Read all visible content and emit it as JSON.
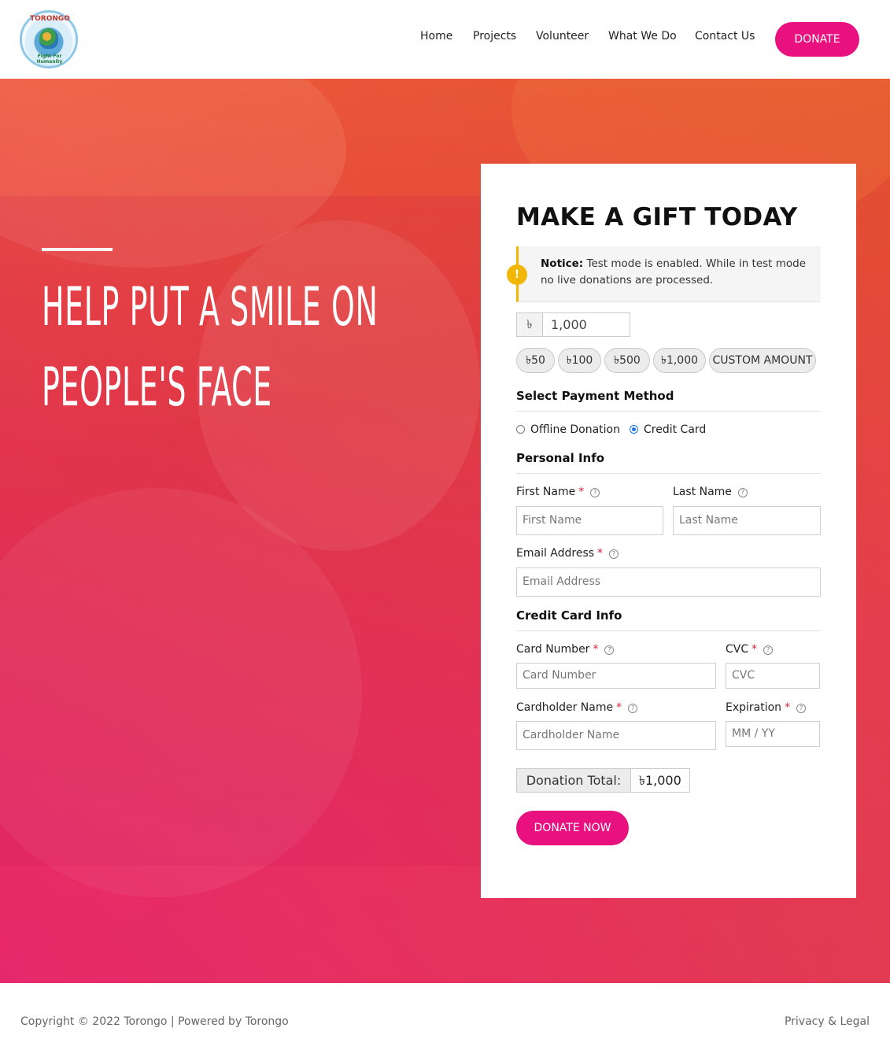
{
  "brand": {
    "logo_top_text": "TORONGO",
    "logo_bottom_text": "Fight For Humanity"
  },
  "nav": {
    "items": [
      "Home",
      "Projects",
      "Volunteer",
      "What We Do",
      "Contact Us"
    ],
    "donate_label": "DONATE"
  },
  "hero": {
    "title_line1": "HELP PUT A SMILE ON",
    "title_line2": "PEOPLE'S FACE"
  },
  "form": {
    "title": "MAKE A GIFT TODAY",
    "notice_strong": "Notice:",
    "notice_text": " Test mode is enabled. While in test mode no live donations are processed.",
    "currency_symbol": "৳",
    "amount_value": "1,000",
    "levels": [
      "৳50",
      "৳100",
      "৳500",
      "৳1,000",
      "CUSTOM AMOUNT"
    ],
    "payment_section": "Select Payment Method",
    "payment_options": [
      "Offline Donation",
      "Credit Card"
    ],
    "selected_payment": "Credit Card",
    "personal_section": "Personal Info",
    "first_name_label": "First Name",
    "first_name_placeholder": "First Name",
    "last_name_label": "Last Name",
    "last_name_placeholder": "Last Name",
    "email_label": "Email Address",
    "email_placeholder": "Email Address",
    "card_section": "Credit Card Info",
    "card_number_label": "Card Number",
    "card_number_placeholder": "Card Number",
    "cvc_label": "CVC",
    "cvc_placeholder": "CVC",
    "cardholder_label": "Cardholder Name",
    "cardholder_placeholder": "Cardholder Name",
    "expiration_label": "Expiration",
    "expiration_placeholder": "MM / YY",
    "total_label": "Donation Total:",
    "total_value": "৳1,000",
    "submit_label": "DONATE NOW",
    "required_mark": "*",
    "help_mark": "?"
  },
  "footer": {
    "copyright": "Copyright © 2022 Torongo | Powered by Torongo",
    "legal": "Privacy & Legal"
  },
  "colors": {
    "accent": "#e8117f",
    "notice_border": "#f2b705",
    "required": "#d9263a"
  }
}
